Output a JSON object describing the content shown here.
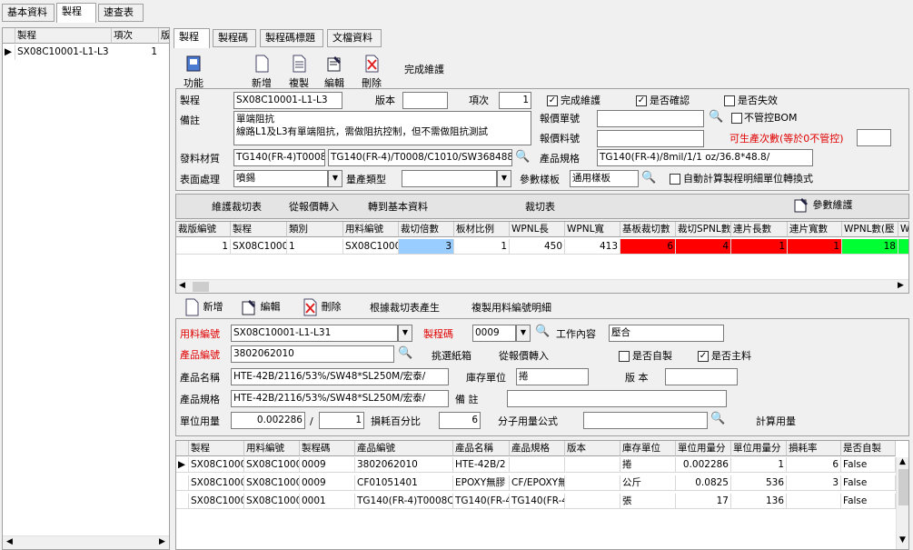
{
  "top_tabs": [
    "基本資料",
    "製程",
    "速查表"
  ],
  "left_grid": {
    "headers": [
      "製程",
      "項次",
      "版"
    ],
    "rows": [
      {
        "name": "SX08C10001-L1-L3",
        "seq": "1"
      }
    ]
  },
  "sub_tabs": [
    "製程",
    "製程碼",
    "製程碼標題",
    "文檔資料"
  ],
  "toolbar": {
    "func": "功能",
    "add": "新增",
    "copy": "複製",
    "edit": "編輯",
    "del": "刪除",
    "done": "完成維護"
  },
  "form1": {
    "process_label": "製程",
    "process_value": "SX08C10001-L1-L3",
    "version_label": "版本",
    "version_value": "",
    "seq_label": "項次",
    "seq_value": "1",
    "done_maint": "完成維護",
    "confirm": "是否確認",
    "invalid": "是否失效",
    "remark_label": "備註",
    "remark_line1": "單端阻抗",
    "remark_line2": "線路L1及L3有單端阻抗，需做阻抗控制，但不需做阻抗測試",
    "quote_no_label": "報價單號",
    "quote_no_value": "",
    "no_bom": "不管控BOM",
    "quote_item_label": "報價料號",
    "quote_item_value": "",
    "prod_count_label": "可生產次數(等於0不管控)",
    "prod_count_value": "",
    "material_label": "發料材質",
    "material_v1": "TG140(FR-4)T0008C",
    "material_v2": "TG140(FR-4)/T0008/C1010/SW368488/",
    "spec_label": "產品規格",
    "spec_value": "TG140(FR-4)/8mil/1/1 oz/36.8*48.8/",
    "surface_label": "表面處理",
    "surface_value": "噴錫",
    "qty_type_label": "量產類型",
    "qty_type_value": "",
    "param_label": "參數樣板",
    "param_value": "通用樣板",
    "auto_calc": "自動計算製程明細單位轉換式"
  },
  "cut_toolbar": {
    "maint": "維護裁切表",
    "from_quote": "從報價轉入",
    "to_basic": "轉到基本資料",
    "cut_table": "裁切表",
    "param_maint": "參數維護"
  },
  "cut_grid": {
    "headers": [
      "裁版編號",
      "製程",
      "類別",
      "用料編號",
      "裁切倍數",
      "板材比例",
      "WPNL長",
      "WPNL寬",
      "基板裁切數",
      "裁切SPNL數",
      "連片長數",
      "連片寬數",
      "WPNL數(壓",
      "W"
    ],
    "rows": [
      {
        "id": "1",
        "proc": "SX08C1000",
        "type": "1",
        "mat": "SX08C1000",
        "mult": "3",
        "ratio": "1",
        "len": "450",
        "wid": "413",
        "base": "6",
        "spnl": "4",
        "clen": "1",
        "cwid": "1",
        "wpnl": "18",
        "w": ""
      }
    ]
  },
  "mid_toolbar": {
    "add": "新增",
    "edit": "編輯",
    "del": "刪除",
    "gen": "根據裁切表產生",
    "copy": "複製用料編號明細"
  },
  "form2": {
    "mat_no_label": "用料編號",
    "mat_no_value": "SX08C10001-L1-L31",
    "proc_code_label": "製程碼",
    "proc_code_value": "0009",
    "work_label": "工作內容",
    "work_value": "壓合",
    "prod_no_label": "產品編號",
    "prod_no_value": "3802062010",
    "pick_box": "挑選紙箱",
    "from_quote": "從報價轉入",
    "self_made": "是否自製",
    "main_mat": "是否主料",
    "prod_name_label": "產品名稱",
    "prod_name_value": "HTE-42B/2116/53%/SW48*SL250M/宏泰/",
    "stock_unit_label": "庫存單位",
    "stock_unit_value": "捲",
    "ver_label": "版 本",
    "ver_value": "",
    "prod_spec_label": "產品規格",
    "prod_spec_value": "HTE-42B/2116/53%/SW48*SL250M/宏泰/",
    "note_label": "備 註",
    "note_value": "",
    "unit_usage_label": "單位用量",
    "unit_usage_value": "0.002286",
    "slash": "/",
    "divisor": "1",
    "loss_label": "損耗百分比",
    "loss_value": "6",
    "formula_label": "分子用量公式",
    "formula_value": "",
    "calc_usage": "計算用量"
  },
  "bottom_grid": {
    "headers": [
      "製程",
      "用料編號",
      "製程碼",
      "產品編號",
      "產品名稱",
      "產品規格",
      "版本",
      "庫存單位",
      "單位用量分",
      "單位用量分",
      "損耗率",
      "是否自製"
    ],
    "rows": [
      {
        "c": [
          "SX08C1000",
          "SX08C1000",
          "0009",
          "3802062010",
          "HTE-42B/2",
          "",
          "",
          "捲",
          "0.002286",
          "1",
          "6",
          "False"
        ]
      },
      {
        "c": [
          "SX08C1000",
          "SX08C1000",
          "0009",
          "CF01051401",
          "EPOXY無膠",
          "CF/EPOXY無",
          "",
          "公斤",
          "0.0825",
          "536",
          "3",
          "False"
        ]
      },
      {
        "c": [
          "SX08C1000",
          "SX08C1000",
          "0001",
          "TG140(FR-4)T0008C1",
          "TG140(FR-4",
          "TG140(FR-4",
          "",
          "張",
          "17",
          "136",
          "",
          "False"
        ]
      }
    ]
  }
}
